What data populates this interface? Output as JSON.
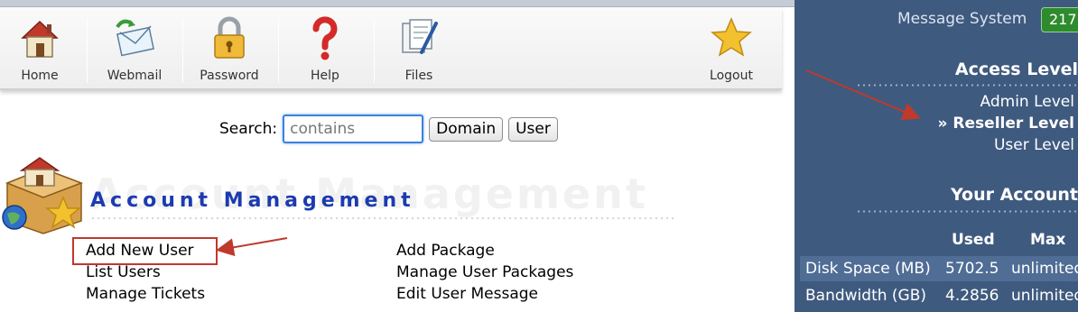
{
  "toolbar": {
    "items": [
      {
        "label": "Home",
        "icon": "home-icon"
      },
      {
        "label": "Webmail",
        "icon": "webmail-icon"
      },
      {
        "label": "Password",
        "icon": "padlock-icon"
      },
      {
        "label": "Help",
        "icon": "question-mark-icon"
      },
      {
        "label": "Files",
        "icon": "files-icon"
      },
      {
        "label": "Logout",
        "icon": "star-icon"
      }
    ]
  },
  "search": {
    "label": "Search:",
    "value": "contains",
    "buttons": {
      "domain": "Domain",
      "user": "User"
    }
  },
  "account_management": {
    "title": "Account Management",
    "watermark": "Account Management",
    "links_left": [
      "Add New User",
      "List Users",
      "Manage Tickets"
    ],
    "links_right": [
      "Add Package",
      "Manage User Packages",
      "Edit User Message"
    ]
  },
  "right_panel": {
    "message_system": "Message System",
    "message_count": "217",
    "access_level": {
      "title": "Access Level",
      "levels": [
        "Admin Level",
        "» Reseller Level",
        "User Level"
      ]
    },
    "your_account": {
      "title": "Your Account",
      "columns": [
        "Used",
        "Max"
      ],
      "rows": [
        {
          "label": "Disk Space (MB)",
          "used": "5702.5",
          "max": "unlimited"
        },
        {
          "label": "Bandwidth (GB)",
          "used": "4.2856",
          "max": "unlimited"
        }
      ]
    }
  },
  "colors": {
    "panel_bg": "#3f5a7f",
    "title_blue": "#1c3bb0",
    "annotation_red": "#c0392b",
    "badge_green": "#2e8b2e"
  }
}
